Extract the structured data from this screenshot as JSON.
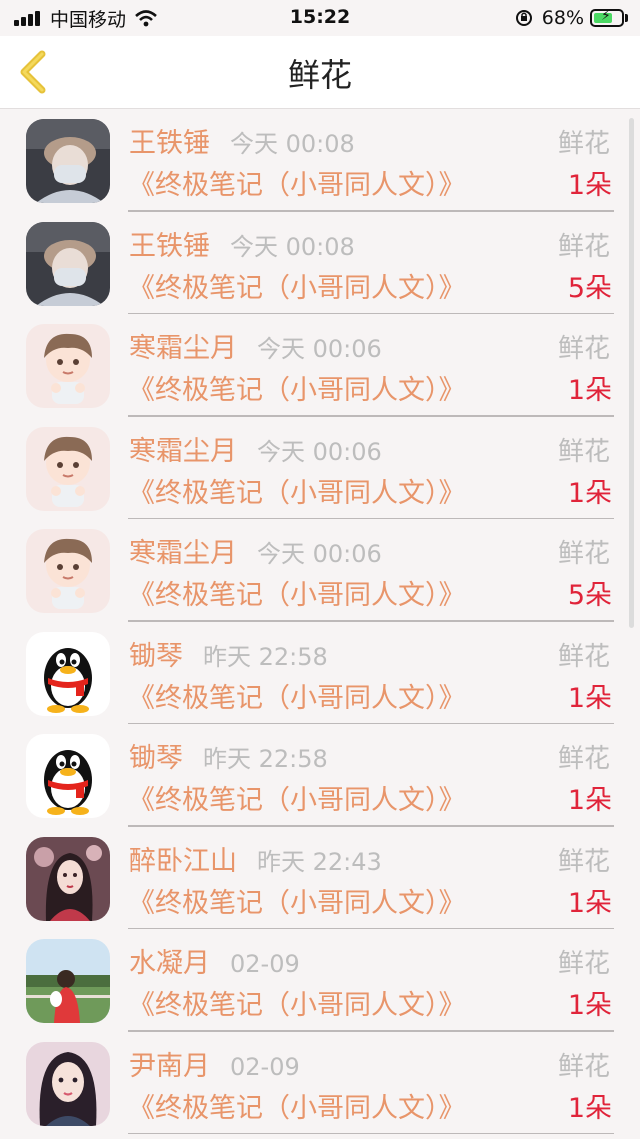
{
  "status_bar": {
    "carrier": "中国移动",
    "time": "15:22",
    "battery": "68%",
    "battery_level": 0.68
  },
  "nav": {
    "title": "鲜花",
    "back_icon": "chevron-left-icon"
  },
  "accent_color": "#e8956a",
  "count_color": "#e0243a",
  "rows": [
    {
      "name": "王铁锤",
      "time": "今天 00:08",
      "gift": "鲜花",
      "book": "《终极笔记（小哥同人文）》",
      "count": "1朵",
      "avatar": "masked-person-avatar"
    },
    {
      "name": "王铁锤",
      "time": "今天 00:08",
      "gift": "鲜花",
      "book": "《终极笔记（小哥同人文）》",
      "count": "5朵",
      "avatar": "masked-person-avatar"
    },
    {
      "name": "寒霜尘月",
      "time": "今天 00:06",
      "gift": "鲜花",
      "book": "《终极笔记（小哥同人文）》",
      "count": "1朵",
      "avatar": "cartoon-boy-avatar"
    },
    {
      "name": "寒霜尘月",
      "time": "今天 00:06",
      "gift": "鲜花",
      "book": "《终极笔记（小哥同人文）》",
      "count": "1朵",
      "avatar": "cartoon-boy-avatar"
    },
    {
      "name": "寒霜尘月",
      "time": "今天 00:06",
      "gift": "鲜花",
      "book": "《终极笔记（小哥同人文）》",
      "count": "5朵",
      "avatar": "cartoon-boy-avatar"
    },
    {
      "name": "锄琴",
      "time": "昨天 22:58",
      "gift": "鲜花",
      "book": "《终极笔记（小哥同人文）》",
      "count": "1朵",
      "avatar": "qq-penguin-avatar"
    },
    {
      "name": "锄琴",
      "time": "昨天 22:58",
      "gift": "鲜花",
      "book": "《终极笔记（小哥同人文）》",
      "count": "1朵",
      "avatar": "qq-penguin-avatar"
    },
    {
      "name": "醉卧江山",
      "time": "昨天 22:43",
      "gift": "鲜花",
      "book": "《终极笔记（小哥同人文）》",
      "count": "1朵",
      "avatar": "ancient-lady-avatar"
    },
    {
      "name": "水凝月",
      "time": "02-09",
      "gift": "鲜花",
      "book": "《终极笔记（小哥同人文）》",
      "count": "1朵",
      "avatar": "outdoor-girl-avatar"
    },
    {
      "name": "尹南月",
      "time": "02-09",
      "gift": "鲜花",
      "book": "《终极笔记（小哥同人文）》",
      "count": "1朵",
      "avatar": "portrait-girl-avatar"
    }
  ]
}
